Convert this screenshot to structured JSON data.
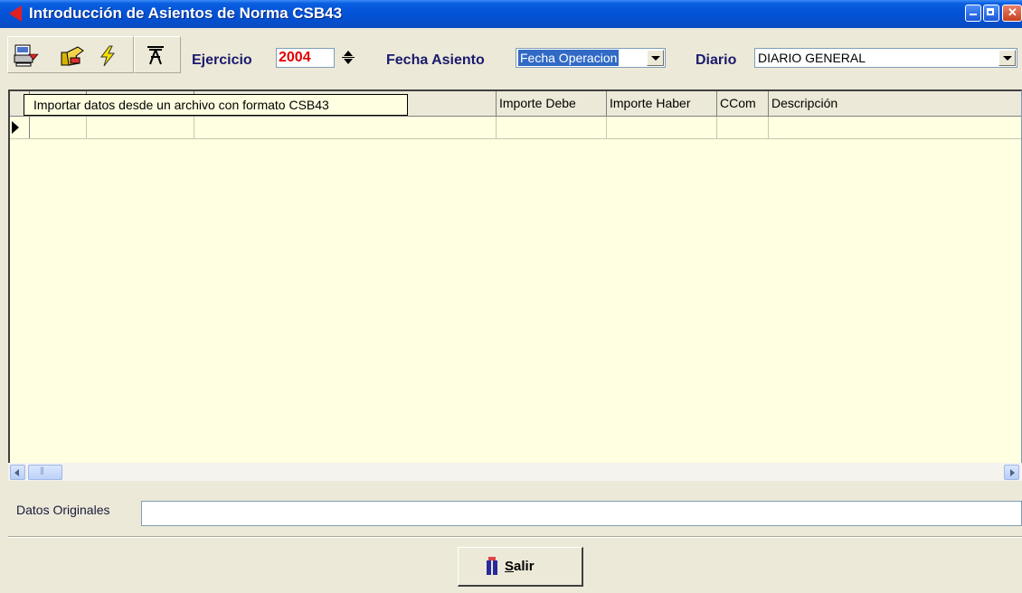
{
  "window": {
    "title": "Introducción de Asientos de Norma CSB43",
    "controls": {
      "minimize": "minimize-icon",
      "maximize": "maximize-icon",
      "close": "close-icon"
    }
  },
  "toolbar": {
    "icons": [
      "import-file-icon",
      "hand-icon",
      "lightning-icon",
      "filter-clear-icon"
    ],
    "ejercicio_label": "Ejercicio",
    "ejercicio_value": "2004",
    "fecha_label": "Fecha Asiento",
    "fecha_value": "Fecha Operacion",
    "diario_label": "Diario",
    "diario_value": "DIARIO GENERAL"
  },
  "tooltip": "Importar datos desde un archivo con formato CSB43",
  "grid": {
    "columns": [
      "",
      "",
      "",
      "Importe Debe",
      "Importe Haber",
      "CCom",
      "Descripción"
    ],
    "rows": [
      [
        "",
        "",
        "",
        "",
        "",
        "",
        ""
      ]
    ]
  },
  "datos_originales": {
    "label": "Datos Originales",
    "value": ""
  },
  "salir": {
    "label_first": "S",
    "label_rest": "alir"
  },
  "colors": {
    "titlebar": "#0554d9",
    "grid_bg": "#ffffe1",
    "ejercicio_value": "#e00000",
    "label_text": "#1a1a6e"
  }
}
